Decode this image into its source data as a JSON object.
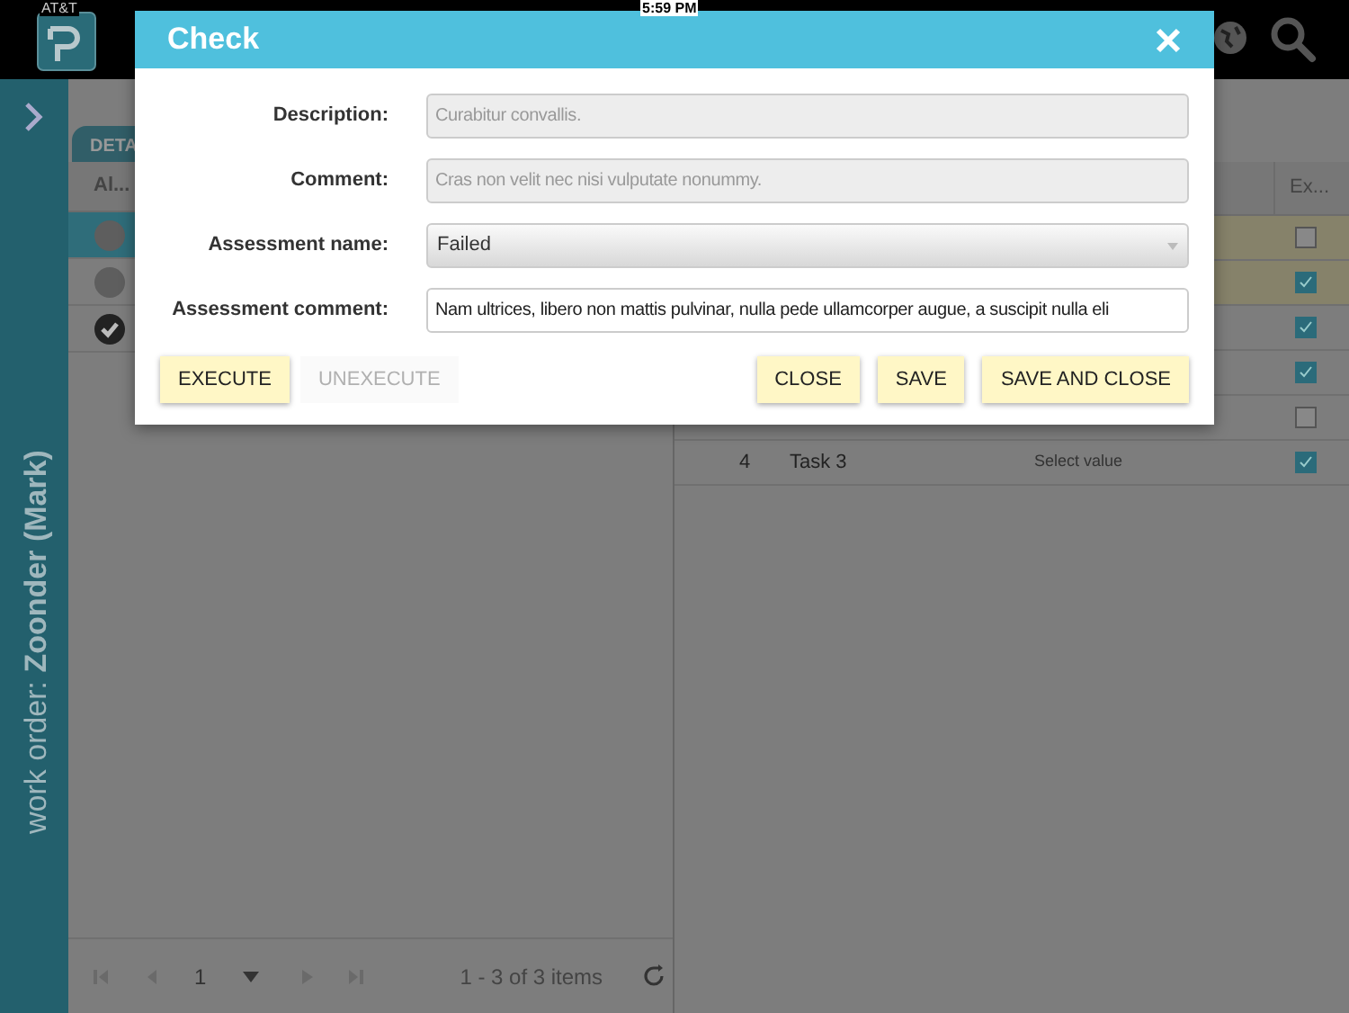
{
  "status_bar": {
    "carrier": "AT&T",
    "time": "5:59 PM"
  },
  "sidebar": {
    "label": "work order: **Zoonder (Mark)**"
  },
  "left_panel": {
    "tab": "DETA",
    "column": "Al...",
    "rows": [
      {
        "kind": "open",
        "selected": true
      },
      {
        "kind": "open",
        "selected": false
      },
      {
        "kind": "done",
        "selected": false
      }
    ],
    "pager": {
      "page": "1",
      "summary": "1 - 3 of 3 items"
    }
  },
  "right_panel": {
    "column": "Ex...",
    "rows": [
      {
        "highlighted": true,
        "checked": false
      },
      {
        "highlighted": true,
        "checked": true
      },
      {
        "highlighted": false,
        "checked": true
      },
      {
        "highlighted": false,
        "checked": true
      },
      {
        "highlighted": false,
        "checked": false
      },
      {
        "highlighted": false,
        "checked": true,
        "number": "4",
        "name": "Task 3",
        "value": "Select value"
      }
    ]
  },
  "dialog": {
    "title": "Check",
    "fields": [
      {
        "label": "Description:",
        "kind": "readonly",
        "placeholder": "Curabitur convallis."
      },
      {
        "label": "Comment:",
        "kind": "readonly",
        "placeholder": "Cras non velit nec nisi vulputate nonummy."
      },
      {
        "label": "Assessment name:",
        "kind": "select",
        "value": "Failed"
      },
      {
        "label": "Assessment comment:",
        "kind": "text",
        "value": "Nam ultrices, libero non mattis pulvinar, nulla pede ullamcorper augue, a suscipit nulla eli"
      }
    ],
    "left_buttons": [
      {
        "label": "EXECUTE",
        "disabled": false
      },
      {
        "label": "UNEXECUTE",
        "disabled": true
      }
    ],
    "right_buttons": [
      {
        "label": "CLOSE",
        "disabled": false
      },
      {
        "label": "SAVE",
        "disabled": false
      },
      {
        "label": "SAVE AND CLOSE",
        "disabled": false
      }
    ]
  }
}
